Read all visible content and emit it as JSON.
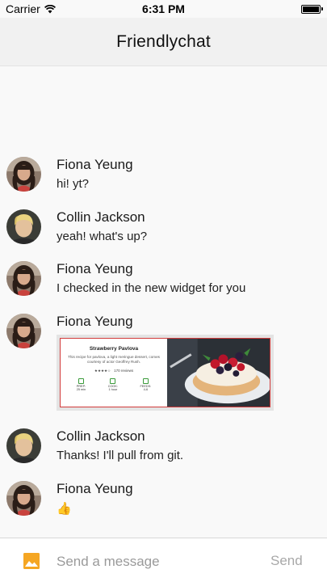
{
  "status_bar": {
    "carrier": "Carrier",
    "wifi_icon": "wifi-icon",
    "time": "6:31 PM",
    "battery_icon": "battery-icon",
    "battery_level": 1.0
  },
  "app_bar": {
    "title": "Friendlychat"
  },
  "messages": [
    {
      "sender": "Fiona Yeung",
      "text": "hi! yt?",
      "avatar": "fiona-avatar"
    },
    {
      "sender": "Collin Jackson",
      "text": "yeah! what's up?",
      "avatar": "collin-avatar"
    },
    {
      "sender": "Fiona Yeung",
      "text": "I checked in the new widget for you",
      "avatar": "fiona-avatar"
    },
    {
      "sender": "Fiona Yeung",
      "avatar": "fiona-avatar",
      "image_card": {
        "title": "Strawberry Pavlova",
        "description": "This recipe for pavlova, a light meringue dessert, comes courtesy of actor Geoffrey Rush.",
        "stars": "★★★★☆",
        "reviews": "170 reviews",
        "stats": [
          {
            "label": "PREP:",
            "value": "25 min"
          },
          {
            "label": "COOK:",
            "value": "1 hour"
          },
          {
            "label": "FEEDS:",
            "value": "4-6"
          }
        ]
      }
    },
    {
      "sender": "Collin Jackson",
      "text": "Thanks! I'll pull from git.",
      "avatar": "collin-avatar"
    },
    {
      "sender": "Fiona Yeung",
      "text": "👍",
      "avatar": "fiona-avatar"
    }
  ],
  "composer": {
    "image_icon": "image-icon",
    "placeholder": "Send a message",
    "value": "",
    "send_label": "Send"
  },
  "colors": {
    "accent": "#f5a623",
    "card_border": "#d23b3b",
    "app_bar_bg": "#f1f1f1",
    "send_disabled": "#a8a8a8"
  }
}
